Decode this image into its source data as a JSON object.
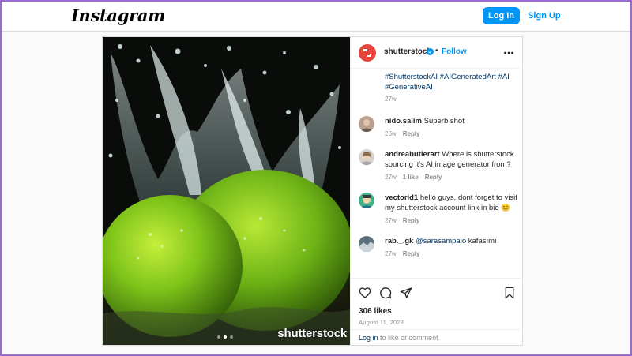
{
  "header": {
    "logo_text": "Instagram",
    "login_label": "Log In",
    "signup_label": "Sign Up"
  },
  "media": {
    "watermark": "shutterstock",
    "carousel_count": 3,
    "active_index": 1
  },
  "post": {
    "account": "shutterstock",
    "separator": "•",
    "follow_label": "Follow",
    "caption_tags": "#ShutterstockAI #AIGeneratedArt #AI #GenerativeAI",
    "caption_time": "27w",
    "comments": [
      {
        "user": "nido.salim",
        "text": "Superb shot",
        "mention": "",
        "time": "26w",
        "likes": "",
        "reply": "Reply"
      },
      {
        "user": "andreabutlerart",
        "text": "Where is shutterstock sourcing it's AI image generator from?",
        "mention": "",
        "time": "27w",
        "likes": "1 like",
        "reply": "Reply"
      },
      {
        "user": "vectorid1",
        "text": "hello guys, dont forget to visit my shutterstock account link in bio 😊",
        "mention": "",
        "time": "27w",
        "likes": "",
        "reply": "Reply"
      },
      {
        "user": "rab._.gk",
        "text": "kafasımı",
        "mention": "@sarasampaio",
        "time": "27w",
        "likes": "",
        "reply": "Reply"
      }
    ],
    "likes_count": "306 likes",
    "date": "August 11, 2023",
    "login_link": "Log in",
    "login_text": "to like or comment."
  },
  "icons": {
    "like": "heart-icon",
    "comment": "comment-icon",
    "share": "share-icon",
    "save": "bookmark-icon",
    "more": "more-options-icon",
    "verified": "verified-badge-icon"
  },
  "colors": {
    "accent": "#0095f6",
    "link": "#00376b",
    "brand_avatar": "#e8433a",
    "frame": "#9b6bd0"
  }
}
